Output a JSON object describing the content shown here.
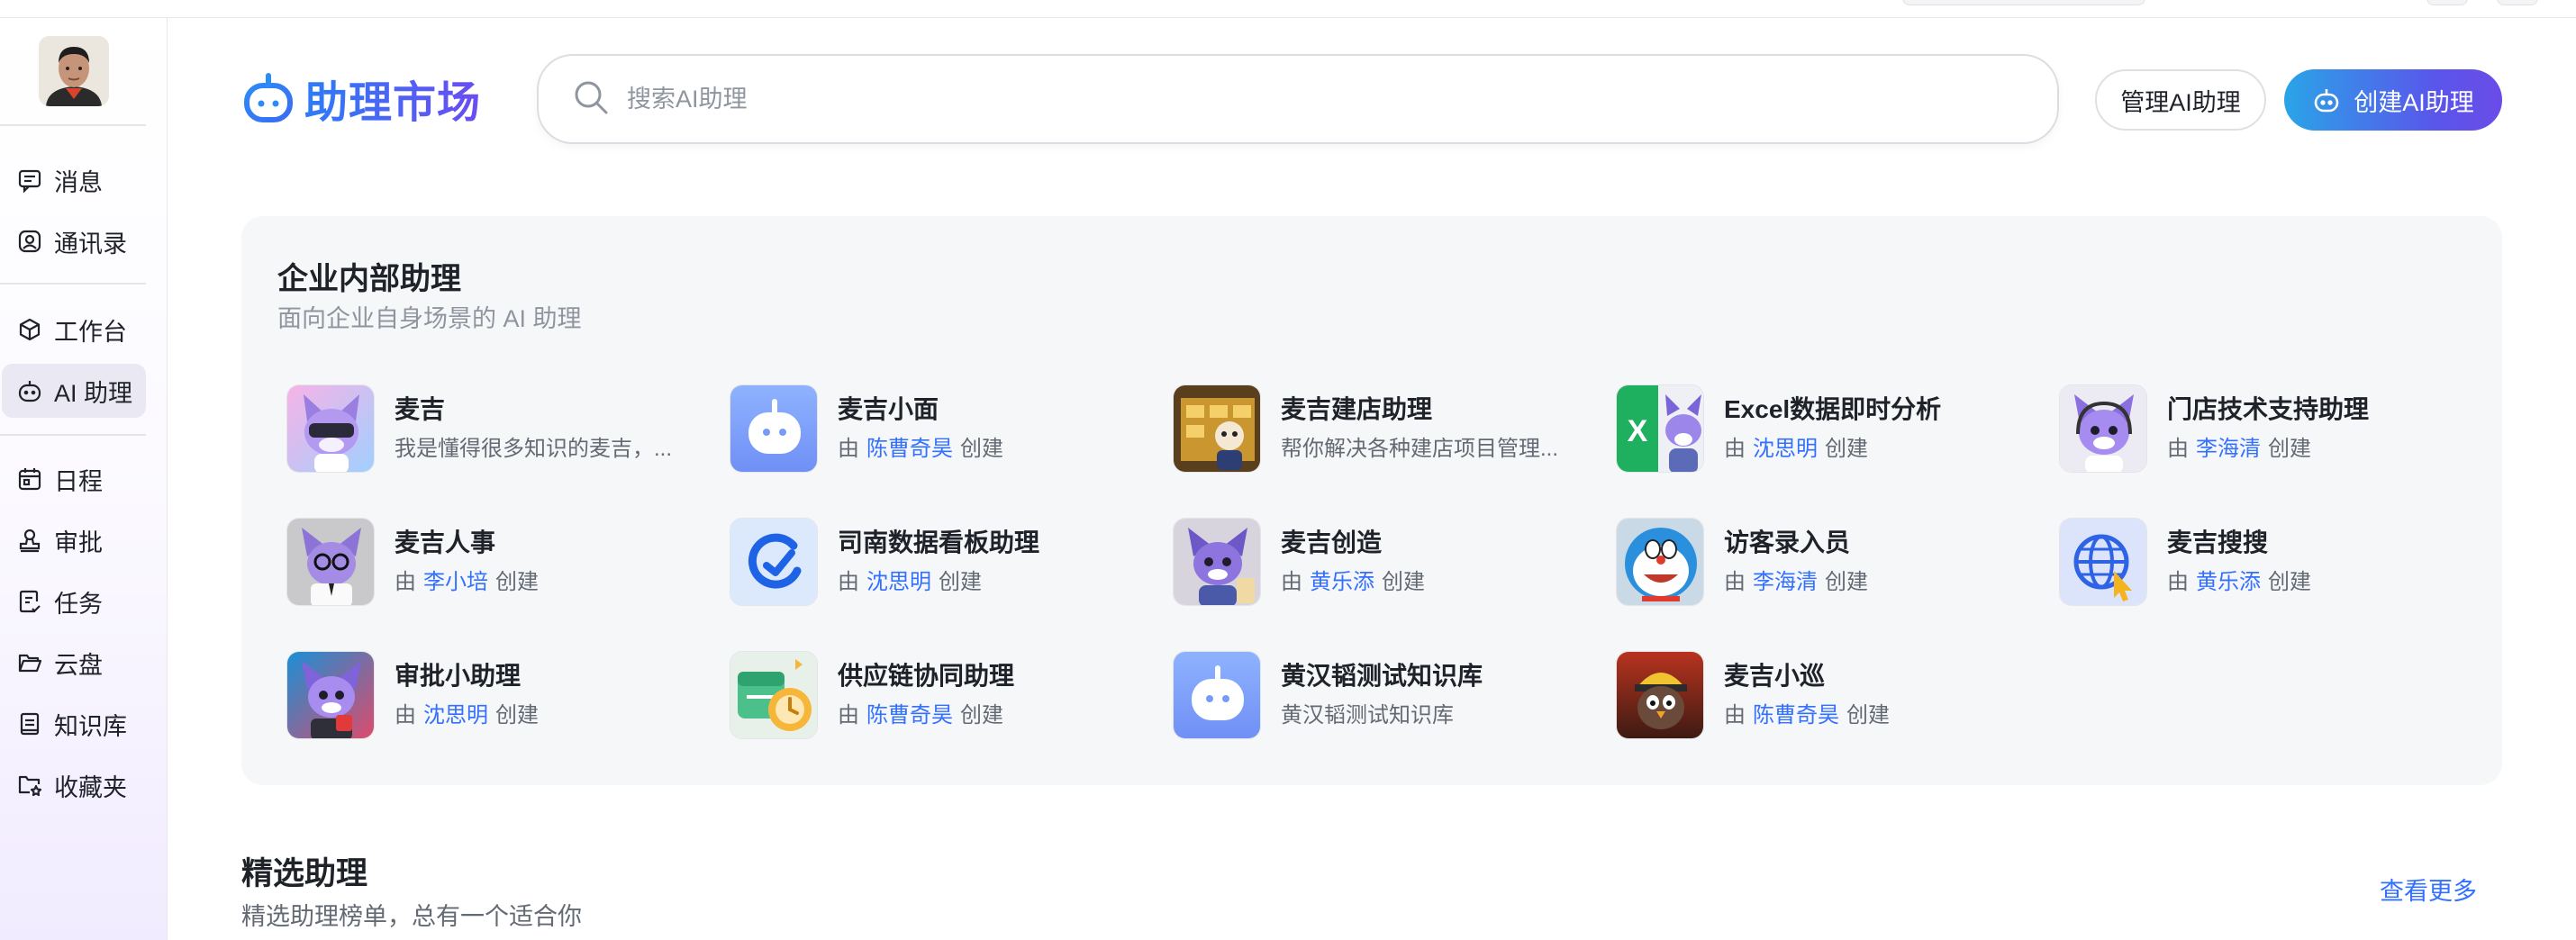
{
  "colors": {
    "accent": "#3370ff",
    "brand_gradient_start": "#2aa4e8",
    "brand_gradient_end": "#6a4ce8",
    "active_bg": "#e9e8f3"
  },
  "sidebar": {
    "items": [
      {
        "label": "消息",
        "icon": "message-icon"
      },
      {
        "label": "通讯录",
        "icon": "contacts-icon"
      },
      {
        "label": "工作台",
        "icon": "workbench-cube-icon"
      },
      {
        "label": "AI 助理",
        "icon": "ai-robot-icon",
        "active": true
      },
      {
        "label": "日程",
        "icon": "calendar-icon"
      },
      {
        "label": "审批",
        "icon": "approval-stamp-icon"
      },
      {
        "label": "任务",
        "icon": "task-icon"
      },
      {
        "label": "云盘",
        "icon": "folder-icon"
      },
      {
        "label": "知识库",
        "icon": "knowledge-book-icon"
      },
      {
        "label": "收藏夹",
        "icon": "favorites-folder-icon"
      }
    ]
  },
  "header": {
    "title": "助理市场",
    "search_placeholder": "搜索AI助理",
    "manage_label": "管理AI助理",
    "create_label": "创建AI助理"
  },
  "internal": {
    "title": "企业内部助理",
    "subtitle": "面向企业自身场景的 AI 助理",
    "by": "由",
    "created": "创建",
    "assistants": [
      {
        "name": "麦吉",
        "desc": "我是懂得很多知识的麦吉，...",
        "thumb": "purple-fox-vr"
      },
      {
        "name": "麦吉小面",
        "author": "陈曹奇昊",
        "thumb": "blue-bot"
      },
      {
        "name": "麦吉建店助理",
        "desc": "帮你解决各种建店项目管理...",
        "thumb": "store-builder"
      },
      {
        "name": "Excel数据即时分析",
        "author": "沈思明",
        "thumb": "excel-fox"
      },
      {
        "name": "门店技术支持助理",
        "author": "李海清",
        "thumb": "purple-fox-headset"
      },
      {
        "name": "麦吉人事",
        "author": "李小培",
        "thumb": "fox-glasses"
      },
      {
        "name": "司南数据看板助理",
        "author": "沈思明",
        "thumb": "compass-logo"
      },
      {
        "name": "麦吉创造",
        "author": "黄乐添",
        "thumb": "fox-creator"
      },
      {
        "name": "访客录入员",
        "author": "李海清",
        "thumb": "blue-cat"
      },
      {
        "name": "麦吉搜搜",
        "author": "黄乐添",
        "thumb": "globe-search"
      },
      {
        "name": "审批小助理",
        "author": "沈思明",
        "thumb": "fox-approval"
      },
      {
        "name": "供应链协同助理",
        "author": "陈曹奇昊",
        "thumb": "supply-chain"
      },
      {
        "name": "黄汉韬测试知识库",
        "desc": "黄汉韬测试知识库",
        "thumb": "blue-bot"
      },
      {
        "name": "麦吉小巡",
        "author": "陈曹奇昊",
        "thumb": "patrol-bird"
      }
    ]
  },
  "featured": {
    "title": "精选助理",
    "subtitle": "精选助理榜单，总有一个适合你",
    "more_label": "查看更多"
  }
}
